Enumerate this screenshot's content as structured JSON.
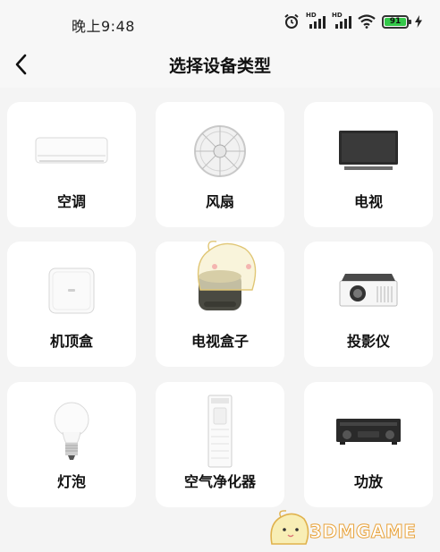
{
  "status_bar": {
    "time": "晚上9:48",
    "battery": "91",
    "hd1": "HD",
    "hd2": "HD"
  },
  "header": {
    "title": "选择设备类型"
  },
  "devices": [
    {
      "label": "空调",
      "icon": "air-conditioner-icon"
    },
    {
      "label": "风扇",
      "icon": "fan-icon"
    },
    {
      "label": "电视",
      "icon": "tv-icon"
    },
    {
      "label": "机顶盒",
      "icon": "set-top-box-icon"
    },
    {
      "label": "电视盒子",
      "icon": "tv-box-icon"
    },
    {
      "label": "投影仪",
      "icon": "projector-icon"
    },
    {
      "label": "灯泡",
      "icon": "light-bulb-icon"
    },
    {
      "label": "空气净化器",
      "icon": "air-purifier-icon"
    },
    {
      "label": "功放",
      "icon": "amplifier-icon"
    }
  ],
  "watermark": {
    "text": "3DMGAME"
  },
  "colors": {
    "background": "#f4f4f4",
    "card": "#ffffff",
    "battery": "#34c84a",
    "watermark": "#e8a23a"
  }
}
